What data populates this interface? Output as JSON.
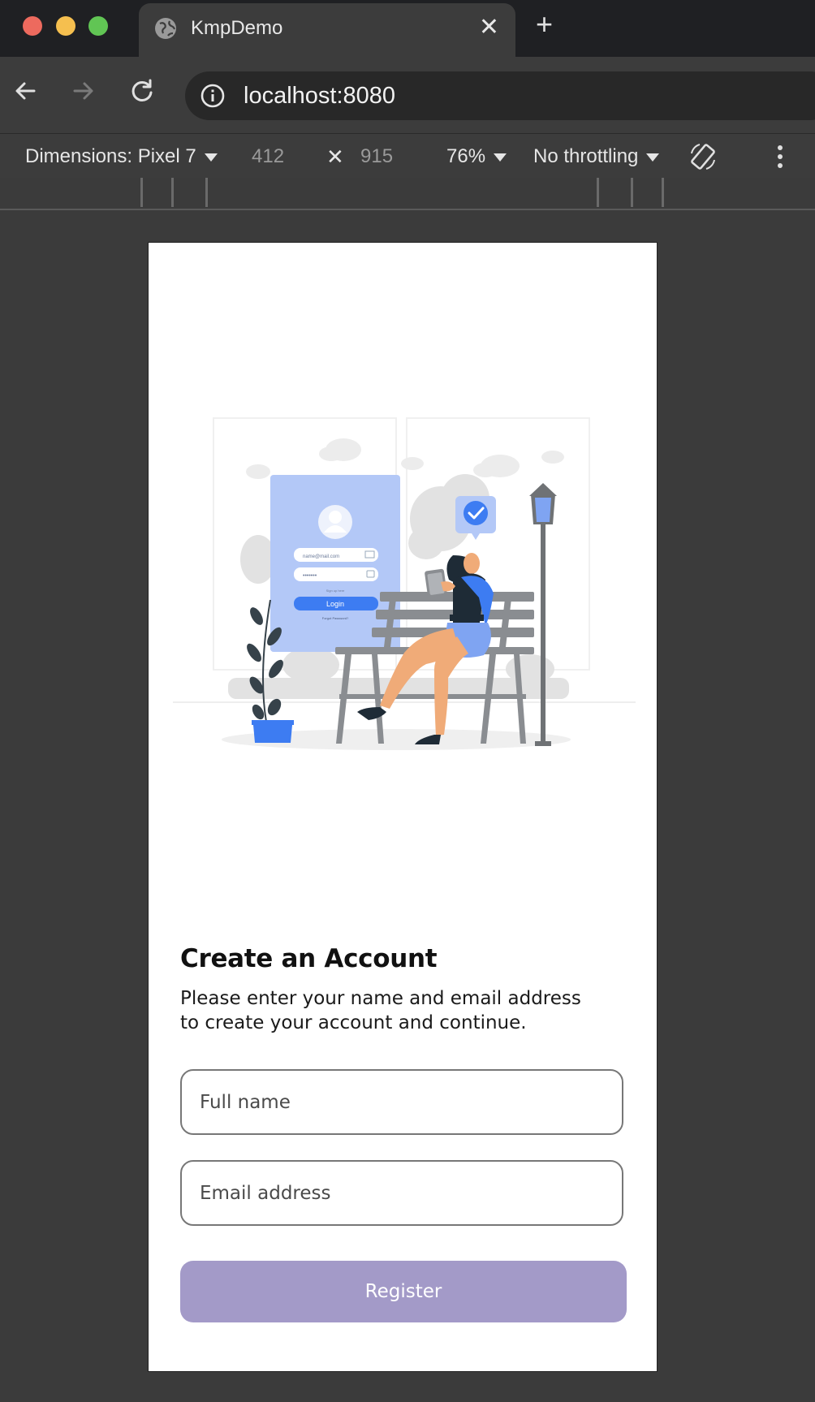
{
  "browser": {
    "tab_title": "KmpDemo",
    "tab_close": "✕",
    "new_tab": "+",
    "url": "localhost:8080"
  },
  "device_toolbar": {
    "dimensions_label": "Dimensions: Pixel 7",
    "width": "412",
    "times": "✕",
    "height": "915",
    "zoom": "76%",
    "throttling": "No throttling"
  },
  "illustration": {
    "email_field_text": "name@mail.com",
    "password_field_text": "•••••••",
    "signup_text": "Sign up here",
    "login_button": "Login",
    "forgot_text": "Forgot Password?"
  },
  "form": {
    "title": "Create an Account",
    "subtitle": "Please enter your name and email address to create your account and continue.",
    "name_placeholder": "Full name",
    "email_placeholder": "Email address",
    "register_label": "Register"
  },
  "colors": {
    "brand_blue": "#3d7cf2",
    "register_button": "#a39ac8",
    "card_blue": "#b3c8f7"
  }
}
